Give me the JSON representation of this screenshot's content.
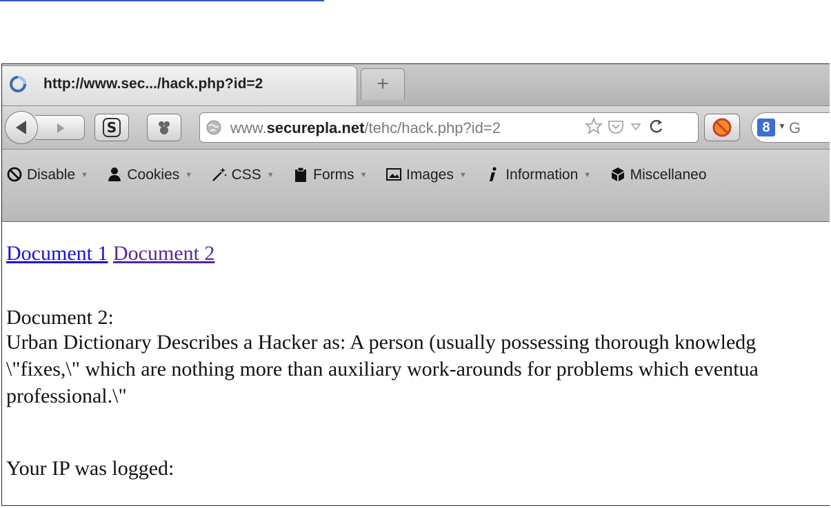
{
  "tab": {
    "title": "http://www.sec.../hack.php?id=2",
    "new_tab_glyph": "+"
  },
  "nav": {
    "url_prefix": "www.",
    "url_host": "securepla.net",
    "url_path": "/tehc/hack.php?id=2",
    "search_engine_glyph": "8",
    "search_text": "G"
  },
  "devbar": {
    "items": [
      {
        "label": "Disable",
        "icon": "disable-icon"
      },
      {
        "label": "Cookies",
        "icon": "cookies-icon"
      },
      {
        "label": "CSS",
        "icon": "css-wand-icon"
      },
      {
        "label": "Forms",
        "icon": "forms-clipboard-icon"
      },
      {
        "label": "Images",
        "icon": "images-icon"
      },
      {
        "label": "Information",
        "icon": "information-icon"
      },
      {
        "label": "Miscellaneo",
        "icon": "miscellaneous-icon"
      }
    ]
  },
  "content": {
    "link1": "Document 1",
    "link2": "Document 2",
    "heading": "Document 2:",
    "lines": [
      "Urban Dictionary Describes a Hacker as: A person (usually possessing thorough knowledg",
      "\\\"fixes,\\\" which are nothing more than auxiliary work-arounds for problems which eventua",
      "professional.\\\""
    ],
    "ip_text": "Your IP was logged:"
  },
  "colors": {
    "link": "#1a10d6",
    "visited_link": "#55279c",
    "top_rule": "#2f56c8"
  }
}
